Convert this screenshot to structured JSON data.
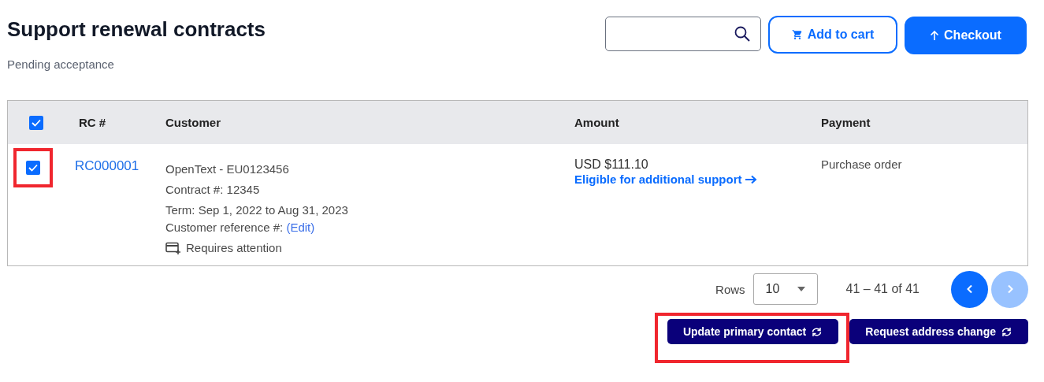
{
  "page": {
    "title": "Support renewal contracts",
    "subtitle": "Pending acceptance"
  },
  "toolbar": {
    "buttons": [
      {
        "label": "Add to cart",
        "kind": "outline"
      },
      {
        "label": "Checkout",
        "kind": "primary"
      }
    ]
  },
  "table": {
    "select_all": {
      "checked": true
    },
    "columns": [
      "RC #",
      "Customer",
      "Amount",
      "Payment"
    ],
    "rows": [
      {
        "checked": true,
        "highlighted": true,
        "rc": "RC000001",
        "customer_lines": [
          "OpenText - EU0123456",
          "Contract #: 12345",
          "Term: Sep 1, 2022 to Aug 31, 2023"
        ],
        "reference_label": "Customer reference #:",
        "reference_link": "(Edit)",
        "attention": "Requires attention",
        "amount": "USD $111.10",
        "amount_link": "Eligible for additional support",
        "payment": "Purchase order"
      }
    ]
  },
  "pagination": {
    "rows_label": "Rows",
    "rows_value": "10",
    "range": "41 – 41 of 41",
    "prev_disabled": false,
    "next_disabled": true
  },
  "actions": [
    {
      "label": "Update primary contact",
      "highlighted": true
    },
    {
      "label": "Request address change",
      "highlighted": false
    }
  ]
}
